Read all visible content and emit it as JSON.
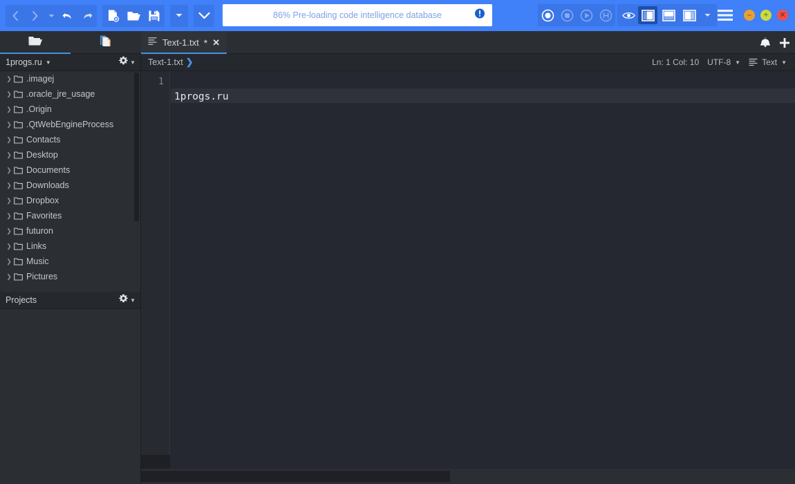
{
  "toolbar": {
    "nav": [
      {
        "name": "back-button",
        "icon": "chevron-left-icon",
        "state": "disabled"
      },
      {
        "name": "forward-button",
        "icon": "chevron-right-icon",
        "state": "disabled"
      },
      {
        "name": "history-dropdown",
        "icon": "caret-down-icon",
        "state": "disabled"
      },
      {
        "name": "undo-button",
        "icon": "undo-arrow-icon",
        "state": "enabled"
      },
      {
        "name": "redo-button",
        "icon": "redo-arrow-icon",
        "state": "enabled"
      }
    ],
    "file_actions": [
      {
        "name": "new-file-button",
        "icon": "new-file-icon"
      },
      {
        "name": "open-file-button",
        "icon": "open-folder-icon"
      },
      {
        "name": "save-file-button",
        "icon": "save-floppy-icon"
      }
    ],
    "more_dropdown": {
      "name": "toolbar-more-dropdown",
      "icon": "caret-down-icon"
    },
    "expand_dropdown": {
      "name": "toolbar-expand-dropdown",
      "icon": "chevron-down-icon"
    },
    "macro": [
      {
        "name": "macro-record-button",
        "icon": "record-circle-icon",
        "state": "enabled"
      },
      {
        "name": "macro-stop-button",
        "icon": "stop-square-icon",
        "state": "disabled"
      },
      {
        "name": "macro-play-button",
        "icon": "play-triangle-icon",
        "state": "disabled"
      },
      {
        "name": "macro-save-button",
        "icon": "save-macro-icon",
        "state": "disabled"
      }
    ],
    "view": {
      "preview": {
        "name": "preview-eye-button",
        "icon": "eye-icon"
      },
      "panes": [
        {
          "name": "toggle-left-pane-button",
          "icon": "left-pane-icon",
          "active": true
        },
        {
          "name": "toggle-bottom-pane-button",
          "icon": "bottom-pane-icon",
          "active": false
        },
        {
          "name": "toggle-right-pane-button",
          "icon": "right-pane-icon",
          "active": false
        }
      ],
      "dropdown": {
        "name": "view-dropdown",
        "icon": "caret-down-icon"
      }
    },
    "menu_button": {
      "name": "hamburger-menu-button",
      "icon": "hamburger-icon"
    },
    "window_controls": [
      {
        "name": "minimize-button",
        "icon": "minus-icon",
        "glyph": "–",
        "color": "#e8a030"
      },
      {
        "name": "maximize-button",
        "icon": "plus-icon",
        "glyph": "+",
        "color": "#c8dc40"
      },
      {
        "name": "close-button",
        "icon": "close-x-icon",
        "glyph": "✕",
        "color": "#f0504a"
      }
    ],
    "accent_color": "#4080f8"
  },
  "status_field": {
    "text": "86% Pre-loading code intelligence database",
    "progress_percent": 86,
    "info_icon": "info-circle-icon",
    "text_color": "#7aa2e8"
  },
  "tabbar": {
    "side_tabs": [
      {
        "name": "places-tab",
        "icon": "open-folder-icon",
        "active": true
      },
      {
        "name": "open-files-tab",
        "icon": "documents-icon",
        "active": false
      }
    ],
    "editor_tab": {
      "icon": "text-lines-icon",
      "label": "Text-1.txt",
      "dirty_marker": "*",
      "close_glyph": "✕"
    },
    "right_icons": [
      {
        "name": "notifications-icon",
        "glyph": "bell"
      },
      {
        "name": "new-tab-plus-icon",
        "glyph": "plus"
      }
    ]
  },
  "sidebar": {
    "places_panel": {
      "title": "1progs.ru",
      "title_caret": "▼",
      "gear_icon": "gear-icon",
      "gear_caret": "▼",
      "items": [
        {
          "label": ".imagej",
          "icon": "folder-icon"
        },
        {
          "label": ".oracle_jre_usage",
          "icon": "folder-icon"
        },
        {
          "label": ".Origin",
          "icon": "folder-icon"
        },
        {
          "label": ".QtWebEngineProcess",
          "icon": "folder-icon"
        },
        {
          "label": "Contacts",
          "icon": "folder-icon"
        },
        {
          "label": "Desktop",
          "icon": "folder-icon"
        },
        {
          "label": "Documents",
          "icon": "folder-icon"
        },
        {
          "label": "Downloads",
          "icon": "folder-icon"
        },
        {
          "label": "Dropbox",
          "icon": "folder-icon"
        },
        {
          "label": "Favorites",
          "icon": "folder-icon"
        },
        {
          "label": "futuron",
          "icon": "folder-icon"
        },
        {
          "label": "Links",
          "icon": "folder-icon"
        },
        {
          "label": "Music",
          "icon": "folder-icon"
        },
        {
          "label": "Pictures",
          "icon": "folder-icon"
        }
      ]
    },
    "projects_panel": {
      "title": "Projects",
      "gear_icon": "gear-icon",
      "gear_caret": "▼"
    }
  },
  "editor": {
    "breadcrumb": {
      "label": "Text-1.txt",
      "chevron": "❯"
    },
    "statusbar": {
      "position": "Ln: 1 Col: 10",
      "encoding": "UTF-8",
      "encoding_caret": "▼",
      "language": "Text",
      "language_caret": "▼",
      "language_icon": "text-lines-icon"
    },
    "lines": [
      {
        "number": "1",
        "text": "1progs.ru"
      }
    ],
    "background_color": "#252830"
  }
}
